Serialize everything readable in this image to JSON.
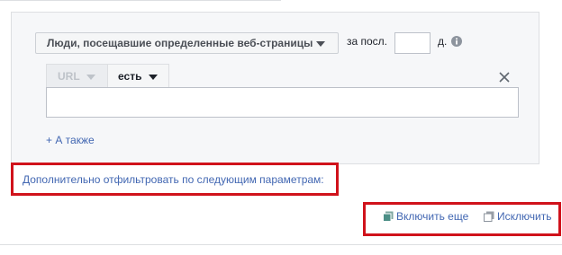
{
  "audience": {
    "dropdown_label": "Люди, посещавшие определенные веб-страницы"
  },
  "retention": {
    "prefix": "за посл.",
    "days_value": "",
    "suffix": "д."
  },
  "rule": {
    "field_label": "URL",
    "operator_label": "есть",
    "value": ""
  },
  "links": {
    "also": "+ А также",
    "filter": "Дополнительно отфильтровать по следующим параметрам:"
  },
  "actions": {
    "include_more": "Включить еще",
    "exclude": "Исключить"
  },
  "colors": {
    "accent": "#4267b2",
    "highlight": "#d0121b",
    "panel": "#f6f7f9"
  },
  "icons": [
    "chevron-down-icon",
    "info-icon",
    "close-icon",
    "include-copy-icon",
    "exclude-copy-icon"
  ]
}
